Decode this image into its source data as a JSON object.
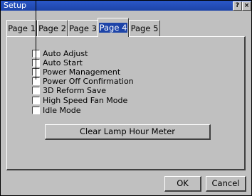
{
  "window": {
    "title": "Setup",
    "help_label": "?",
    "close_label": "×"
  },
  "tabs": [
    {
      "label": "Page 1",
      "active": false
    },
    {
      "label": "Page 2",
      "active": false
    },
    {
      "label": "Page 3",
      "active": false
    },
    {
      "label": "Page 4",
      "active": true
    },
    {
      "label": "Page 5",
      "active": false
    }
  ],
  "options": [
    {
      "label": "Auto Adjust",
      "checked": false
    },
    {
      "label": "Auto Start",
      "checked": false
    },
    {
      "label": "Power Management",
      "checked": false
    },
    {
      "label": "Power Off Confirmation",
      "checked": false
    },
    {
      "label": "3D Reform Save",
      "checked": false
    },
    {
      "label": "High Speed Fan Mode",
      "checked": false
    },
    {
      "label": "Idle Mode",
      "checked": false
    }
  ],
  "clear_lamp_label": "Clear Lamp Hour Meter",
  "buttons": {
    "ok_label": "OK",
    "cancel_label": "Cancel"
  }
}
